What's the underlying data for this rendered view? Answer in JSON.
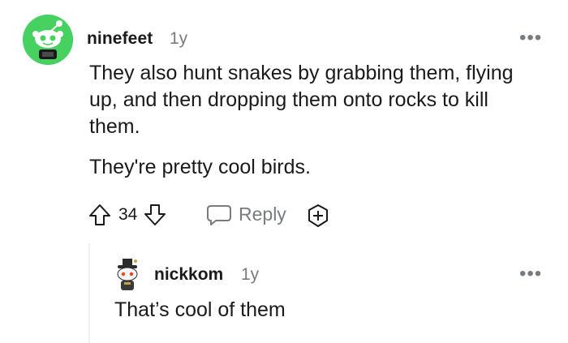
{
  "comment": {
    "author": "ninefeet",
    "age": "1y",
    "more_label": "•••",
    "avatar_icon": "snoo-avatar-icon",
    "paragraphs": [
      "They also hunt snakes by grabbing them, flying up, and then dropping them onto rocks to kill them.",
      "They're pretty cool birds."
    ],
    "score": "34",
    "reply_label": "Reply",
    "icons": {
      "upvote": "upvote-arrow-icon",
      "downvote": "downvote-arrow-icon",
      "reply": "speech-bubble-icon",
      "award": "award-plus-icon"
    }
  },
  "reply": {
    "author": "nickkom",
    "age": "1y",
    "more_label": "•••",
    "avatar_icon": "snoo-avatar-icon",
    "text": "That’s cool of them"
  },
  "colors": {
    "avatar_bg": "#46d160",
    "meta_gray": "#787c7e",
    "thread_line": "#edeff1",
    "text": "#1a1a1b"
  }
}
